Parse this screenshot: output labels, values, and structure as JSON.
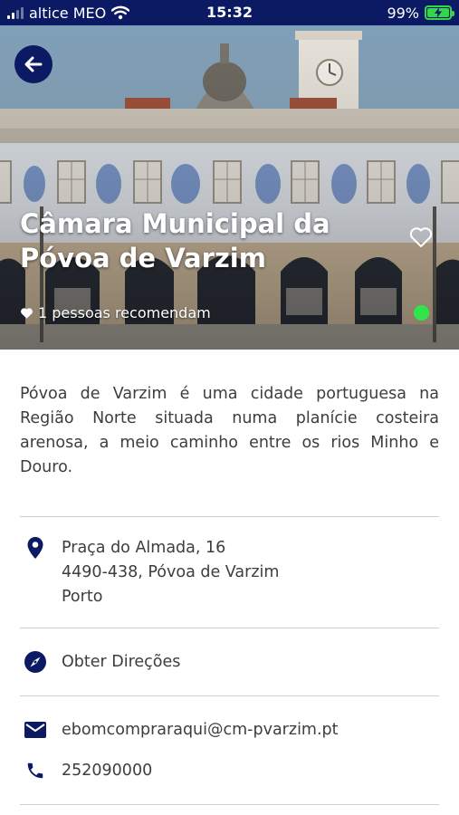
{
  "status_bar": {
    "carrier": "altice MEO",
    "time": "15:32",
    "battery": "99%",
    "battery_level": 0.99
  },
  "place": {
    "title": "Câmara Municipal da Póvoa de Varzim",
    "recommendations": "1 pessoas recomendam",
    "status_color": "#2ee64a",
    "description": "Póvoa de Varzim é uma cidade portuguesa na Região Norte situada numa planície costeira arenosa, a meio caminho entre os rios Minho e Douro."
  },
  "address": {
    "line1": "Praça do Almada, 16",
    "line2": "4490-438, Póvoa de Varzim",
    "line3": "Porto"
  },
  "directions": {
    "label": "Obter Direções"
  },
  "contacts": {
    "email": "ebomcompraraqui@cm-pvarzim.pt",
    "phone": "252090000"
  },
  "colors": {
    "brand": "#0b1a63",
    "icon": "#0b1a63"
  },
  "icons": {
    "back": "arrow-left-icon",
    "favorite": "heart-outline-icon",
    "recommend": "heart-filled-icon",
    "location": "map-pin-icon",
    "directions": "compass-icon",
    "email": "envelope-icon",
    "phone": "phone-icon"
  }
}
